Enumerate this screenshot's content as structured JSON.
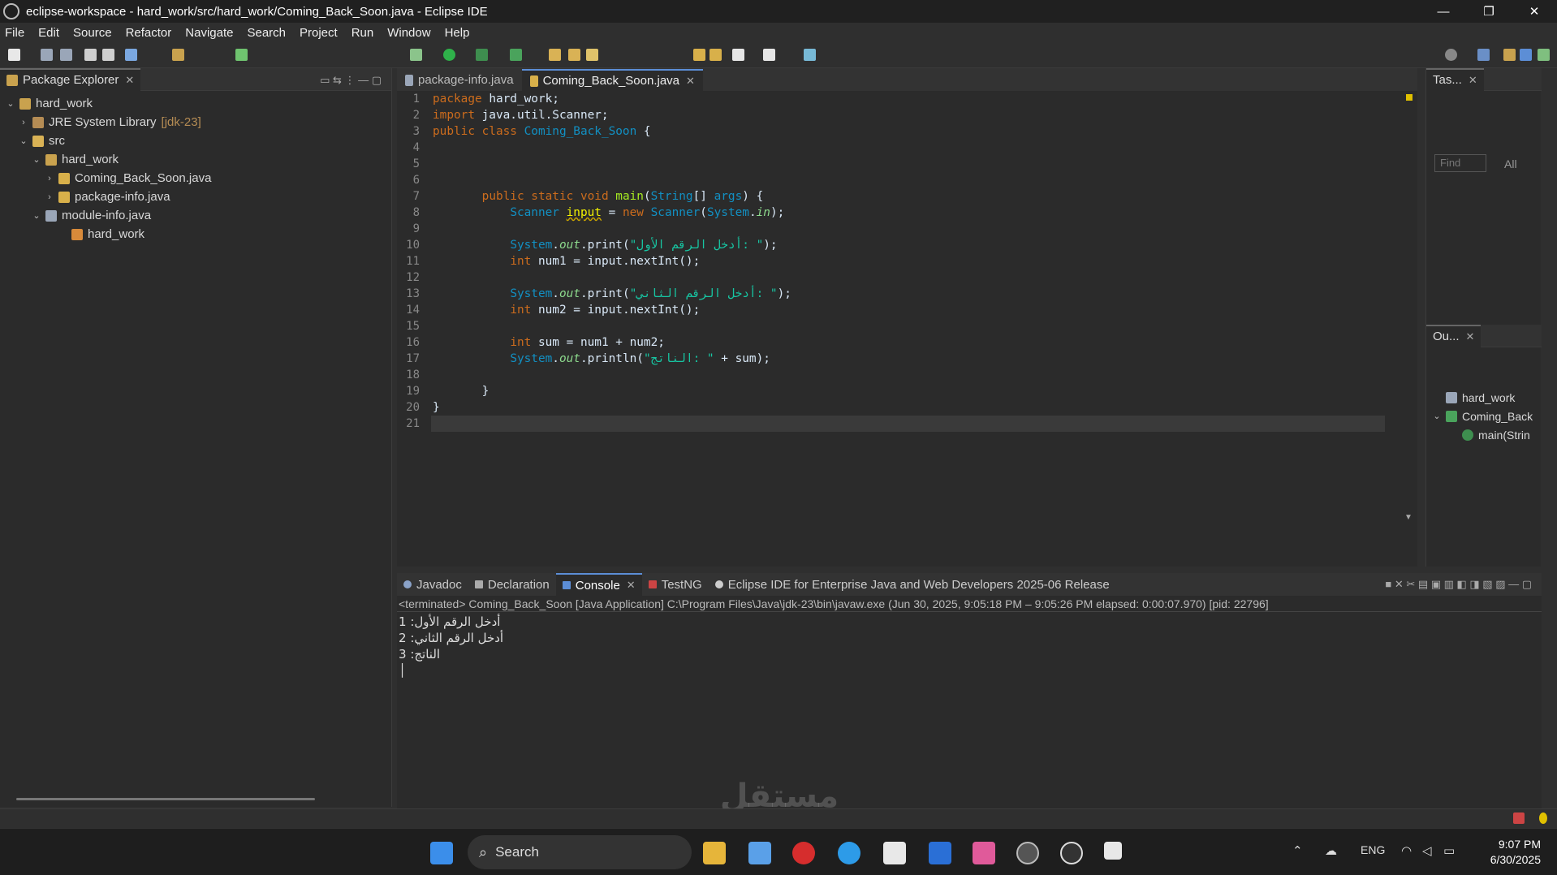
{
  "window": {
    "title": "eclipse-workspace - hard_work/src/hard_work/Coming_Back_Soon.java - Eclipse IDE",
    "min": "—",
    "max": "❐",
    "close": "✕"
  },
  "menu": [
    "File",
    "Edit",
    "Source",
    "Refactor",
    "Navigate",
    "Search",
    "Project",
    "Run",
    "Window",
    "Help"
  ],
  "package_explorer": {
    "tab": "Package Explorer",
    "tree": [
      {
        "caret": "⌄",
        "label": "hard_work",
        "extra": "",
        "indent": 0,
        "icon": "project-icon"
      },
      {
        "caret": "›",
        "label": "JRE System Library",
        "extra": "[jdk-23]",
        "indent": 1,
        "icon": "library-icon"
      },
      {
        "caret": "⌄",
        "label": "src",
        "extra": "",
        "indent": 1,
        "icon": "source-folder-icon"
      },
      {
        "caret": "⌄",
        "label": "hard_work",
        "extra": "",
        "indent": 2,
        "icon": "package-icon"
      },
      {
        "caret": "›",
        "label": "Coming_Back_Soon.java",
        "extra": "",
        "indent": 3,
        "icon": "java-file-icon"
      },
      {
        "caret": "›",
        "label": "package-info.java",
        "extra": "",
        "indent": 3,
        "icon": "java-file-icon"
      },
      {
        "caret": "⌄",
        "label": "module-info.java",
        "extra": "",
        "indent": 2,
        "icon": "module-file-icon"
      },
      {
        "caret": "",
        "label": "hard_work",
        "extra": "",
        "indent": 4,
        "icon": "module-icon"
      }
    ]
  },
  "editor": {
    "tabs": [
      "package-info.java",
      "Coming_Back_Soon.java"
    ],
    "line_numbers": [
      "1",
      "2",
      "3",
      "4",
      "5",
      "6",
      "7",
      "8",
      "9",
      "10",
      "11",
      "12",
      "13",
      "14",
      "15",
      "16",
      "17",
      "18",
      "19",
      "20",
      "21"
    ]
  },
  "console": {
    "tabs": [
      "Javadoc",
      "Declaration",
      "Console",
      "TestNG",
      "Eclipse IDE for Enterprise Java and Web Developers 2025-06 Release"
    ],
    "terminated": "<terminated> Coming_Back_Soon [Java Application] C:\\Program Files\\Java\\jdk-23\\bin\\javaw.exe  (Jun 30, 2025, 9:05:18 PM – 9:05:26 PM elapsed: 0:00:07.970) [pid: 22796]",
    "output": [
      "أدخل الرقم الأول: 1",
      "أدخل الرقم الثاني: 2",
      "الناتج: 3"
    ]
  },
  "task_view": {
    "tab": "Tas...",
    "find_placeholder": "Find",
    "all": "All"
  },
  "outline": {
    "tab": "Ou...",
    "items": [
      "hard_work",
      "Coming_Back",
      "main(Strin"
    ]
  },
  "taskbar": {
    "search": "Search",
    "lang": "ENG",
    "time": "9:07 PM",
    "date": "6/30/2025"
  },
  "watermark": "مستقل"
}
